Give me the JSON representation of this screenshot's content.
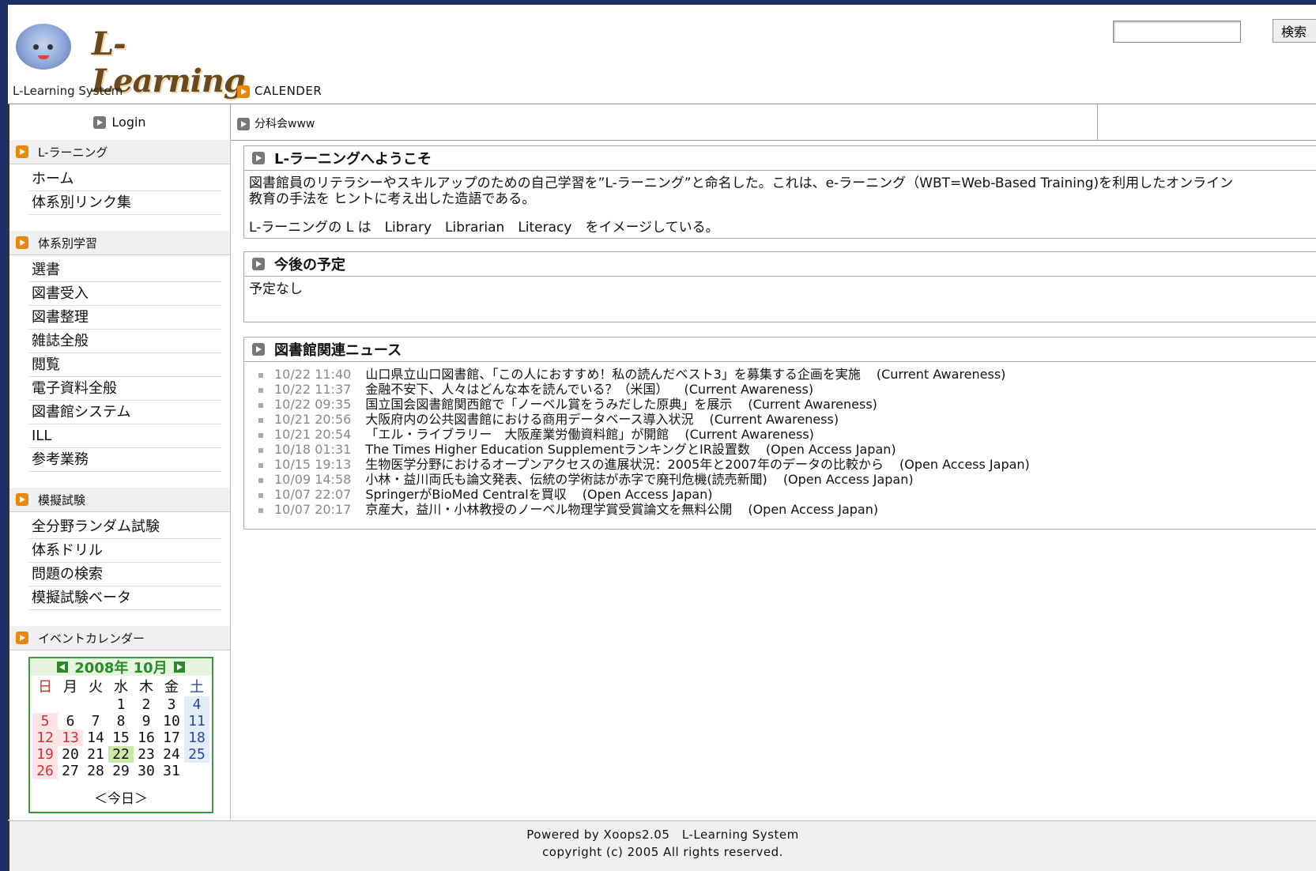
{
  "header": {
    "logo_text": "L-Learning",
    "system_name": "L-Learning System",
    "search_button": "検索",
    "calendar_link": "CALENDER"
  },
  "navrow": {
    "login": "Login",
    "subgroup": "分科会www"
  },
  "sidebar": {
    "sections": [
      {
        "title": "L-ラーニング",
        "items": [
          "ホーム",
          "体系別リンク集"
        ]
      },
      {
        "title": "体系別学習",
        "items": [
          "選書",
          "図書受入",
          "図書整理",
          "雑誌全般",
          "閲覧",
          "電子資料全般",
          "図書館システム",
          "ILL",
          "参考業務"
        ]
      },
      {
        "title": "模擬試験",
        "items": [
          "全分野ランダム試験",
          "体系ドリル",
          "問題の検索",
          "模擬試験ベータ"
        ]
      },
      {
        "title": "イベントカレンダー",
        "items": []
      }
    ]
  },
  "calendar": {
    "title": "2008年 10月",
    "weekdays": [
      "日",
      "月",
      "火",
      "水",
      "木",
      "金",
      "土"
    ],
    "weeks": [
      [
        "",
        "",
        "",
        "1",
        "2",
        "3",
        "4"
      ],
      [
        "5",
        "6",
        "7",
        "8",
        "9",
        "10",
        "11"
      ],
      [
        "12",
        "13",
        "14",
        "15",
        "16",
        "17",
        "18"
      ],
      [
        "19",
        "20",
        "21",
        "22",
        "23",
        "24",
        "25"
      ],
      [
        "26",
        "27",
        "28",
        "29",
        "30",
        "31",
        ""
      ]
    ],
    "today": "22",
    "holidays": [
      "13"
    ],
    "today_link": "＜今日＞"
  },
  "welcome": {
    "title": "L-ラーニングへようこそ",
    "line1": "図書館員のリテラシーやスキルアップのための自己学習を”L-ラーニング”と命名した。これは、e-ラーニング（WBT=Web-Based Training)を利用したオンライン",
    "line2": "教育の手法を ヒントに考え出した造語である。",
    "line3": "L-ラーニングの L は　Library　Librarian　Literacy　をイメージしている。"
  },
  "schedule": {
    "title": "今後の予定",
    "body": "予定なし"
  },
  "news": {
    "title": "図書館関連ニュース",
    "items": [
      {
        "time": "10/22 11:40",
        "title": "山口県立山口図書館、「この人におすすめ！私の読んだベスト3」を募集する企画を実施",
        "source": "(Current Awareness)"
      },
      {
        "time": "10/22 11:37",
        "title": "金融不安下、人々はどんな本を読んでいる？（米国）",
        "source": "(Current Awareness)"
      },
      {
        "time": "10/22 09:35",
        "title": "国立国会図書館関西館で「ノーベル賞をうみだした原典」を展示",
        "source": "(Current Awareness)"
      },
      {
        "time": "10/21 20:56",
        "title": "大阪府内の公共図書館における商用データベース導入状況",
        "source": "(Current Awareness)"
      },
      {
        "time": "10/21 20:54",
        "title": "「エル・ライブラリー　大阪産業労働資料館」が開館",
        "source": "(Current Awareness)"
      },
      {
        "time": "10/18 01:31",
        "title": "The Times Higher Education SupplementランキングとIR設置数",
        "source": "(Open Access Japan)"
      },
      {
        "time": "10/15 19:13",
        "title": "生物医学分野におけるオープンアクセスの進展状況：2005年と2007年のデータの比較から",
        "source": "(Open Access Japan)"
      },
      {
        "time": "10/09 14:58",
        "title": "小林・益川両氏も論文発表、伝統の学術誌が赤字で廃刊危機(読売新聞)",
        "source": "(Open Access Japan)"
      },
      {
        "time": "10/07 22:07",
        "title": "SpringerがBioMed Centralを買収",
        "source": "(Open Access Japan)"
      },
      {
        "time": "10/07 20:17",
        "title": "京産大，益川・小林教授のノーベル物理学賞受賞論文を無料公開",
        "source": "(Open Access Japan)"
      }
    ]
  },
  "footer": {
    "line1": "Powered by Xoops2.05　L-Learning System",
    "line2": "copyright (c) 2005 All rights reserved."
  },
  "colors": {
    "accent": "#e8870c",
    "calendar_green": "#3b9b3b",
    "outer_bg": "#1e2f66"
  }
}
